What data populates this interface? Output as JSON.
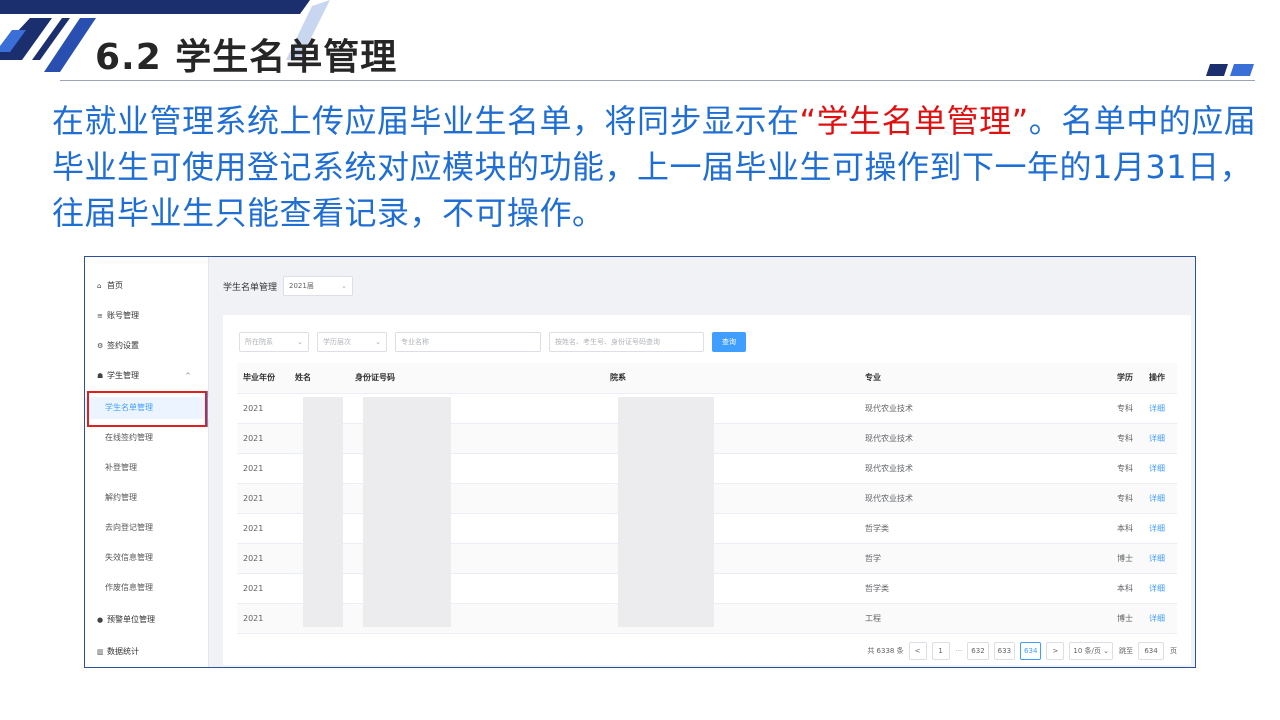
{
  "slide": {
    "title": "6.2 学生名单管理",
    "intro_before": "在就业管理系统上传应届毕业生名单，将同步显示在",
    "intro_highlight": "“学生名单管理”",
    "intro_after": "。名单中的应届毕业生可使用登记系统对应模块的功能，上一届毕业生可操作到下一年的1月31日，往届毕业生只能查看记录，不可操作。",
    "colors": {
      "intro": "#1f6ed4",
      "highlight": "#e01010",
      "accent": "#409eff"
    }
  },
  "sidebar": {
    "items": [
      {
        "icon": "home-icon",
        "glyph": "⌂",
        "label": "首页"
      },
      {
        "icon": "list-icon",
        "glyph": "≡",
        "label": "账号管理"
      },
      {
        "icon": "settings-icon",
        "glyph": "⚙",
        "label": "签约设置"
      },
      {
        "icon": "student-icon",
        "glyph": "☗",
        "label": "学生管理",
        "arrow": "^"
      },
      {
        "label": "学生名单管理"
      },
      {
        "label": "在线签约管理"
      },
      {
        "label": "补登管理"
      },
      {
        "label": "解约管理"
      },
      {
        "label": "去向登记管理"
      },
      {
        "label": "失效信息管理"
      },
      {
        "label": "作废信息管理"
      },
      {
        "icon": "employer-icon",
        "glyph": "●",
        "label": "预警单位管理"
      },
      {
        "icon": "chart-icon",
        "glyph": "▥",
        "label": "数据统计"
      }
    ]
  },
  "topbar": {
    "label": "学生名单管理",
    "year": "2021届"
  },
  "filters": {
    "college": "所在院系",
    "level": "学历层次",
    "major_placeholder": "专业名称",
    "search_placeholder": "按姓名、考生号、身份证号码查询",
    "query_button": "查询"
  },
  "table": {
    "headers": [
      "毕业年份",
      "姓名",
      "身份证号码",
      "院系",
      "专业",
      "学历",
      "操作"
    ],
    "rows": [
      [
        "2021",
        "",
        "",
        "",
        "现代农业技术",
        "专科",
        "详细"
      ],
      [
        "2021",
        "",
        "",
        "",
        "现代农业技术",
        "专科",
        "详细"
      ],
      [
        "2021",
        "",
        "",
        "",
        "现代农业技术",
        "专科",
        "详细"
      ],
      [
        "2021",
        "",
        "",
        "",
        "现代农业技术",
        "专科",
        "详细"
      ],
      [
        "2021",
        "",
        "",
        "",
        "哲学类",
        "本科",
        "详细"
      ],
      [
        "2021",
        "",
        "",
        "",
        "哲学",
        "博士",
        "详细"
      ],
      [
        "2021",
        "",
        "",
        "",
        "哲学类",
        "本科",
        "详细"
      ],
      [
        "2021",
        "",
        "",
        "",
        "工程",
        "博士",
        "详细"
      ]
    ]
  },
  "pager": {
    "total": "共 6338 条",
    "prev": "<",
    "first": "1",
    "ellipsis": "···",
    "pages": [
      "632",
      "633",
      "634"
    ],
    "current": "634",
    "next": ">",
    "size": "10 条/页",
    "goto_label": "跳至",
    "goto_value": "634",
    "page_unit": "页"
  }
}
